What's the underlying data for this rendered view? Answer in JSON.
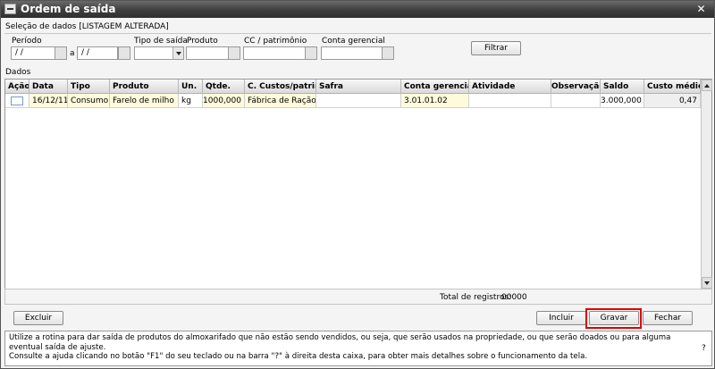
{
  "window": {
    "title": "Ordem de saída",
    "close": "✕"
  },
  "selection": {
    "header": "Seleção de dados [LISTAGEM ALTERADA]",
    "periodo_label": "Período",
    "periodo_from": " / /",
    "periodo_sep": "a",
    "periodo_to": " / /",
    "tipo_label": "Tipo de saída",
    "produto_label": "Produto",
    "cc_label": "CC / patrimônio",
    "conta_label": "Conta gerencial",
    "filtrar": "Filtrar"
  },
  "grid": {
    "label": "Dados",
    "columns": [
      "Ação",
      "Data",
      "Tipo",
      "Produto",
      "Un.",
      "Qtde.",
      "C. Custos/patrim.",
      "Safra",
      "Conta gerencial",
      "Atividade",
      "Observação",
      "Saldo",
      "Custo médio"
    ],
    "rows": [
      {
        "data": "16/12/11",
        "tipo": "Consumo",
        "produto": "Farelo de milho",
        "un": "kg",
        "qtde": "1000,000",
        "ccustos": "Fábrica de Ração",
        "safra": "",
        "conta": "3.01.01.02",
        "atividade": "",
        "obs": "",
        "saldo": "3.000,000",
        "custo": "0,47"
      }
    ]
  },
  "footer": {
    "total_label": "Total de registros:",
    "total_value": "00000"
  },
  "buttons": {
    "excluir": "Excluir",
    "incluir": "Incluir",
    "gravar": "Gravar",
    "fechar": "Fechar"
  },
  "help": {
    "line1": "Utilize a rotina para dar saída de produtos do almoxarifado que não estão sendo vendidos, ou seja, que serão usados na propriedade, ou que serão doados ou para alguma eventual saída de ajuste.",
    "line2": "Consulte a ajuda clicando no botão \"F1\" do seu teclado ou na barra \"?\" à direita desta caixa, para obter mais detalhes sobre o funcionamento da tela.",
    "question": "?"
  }
}
